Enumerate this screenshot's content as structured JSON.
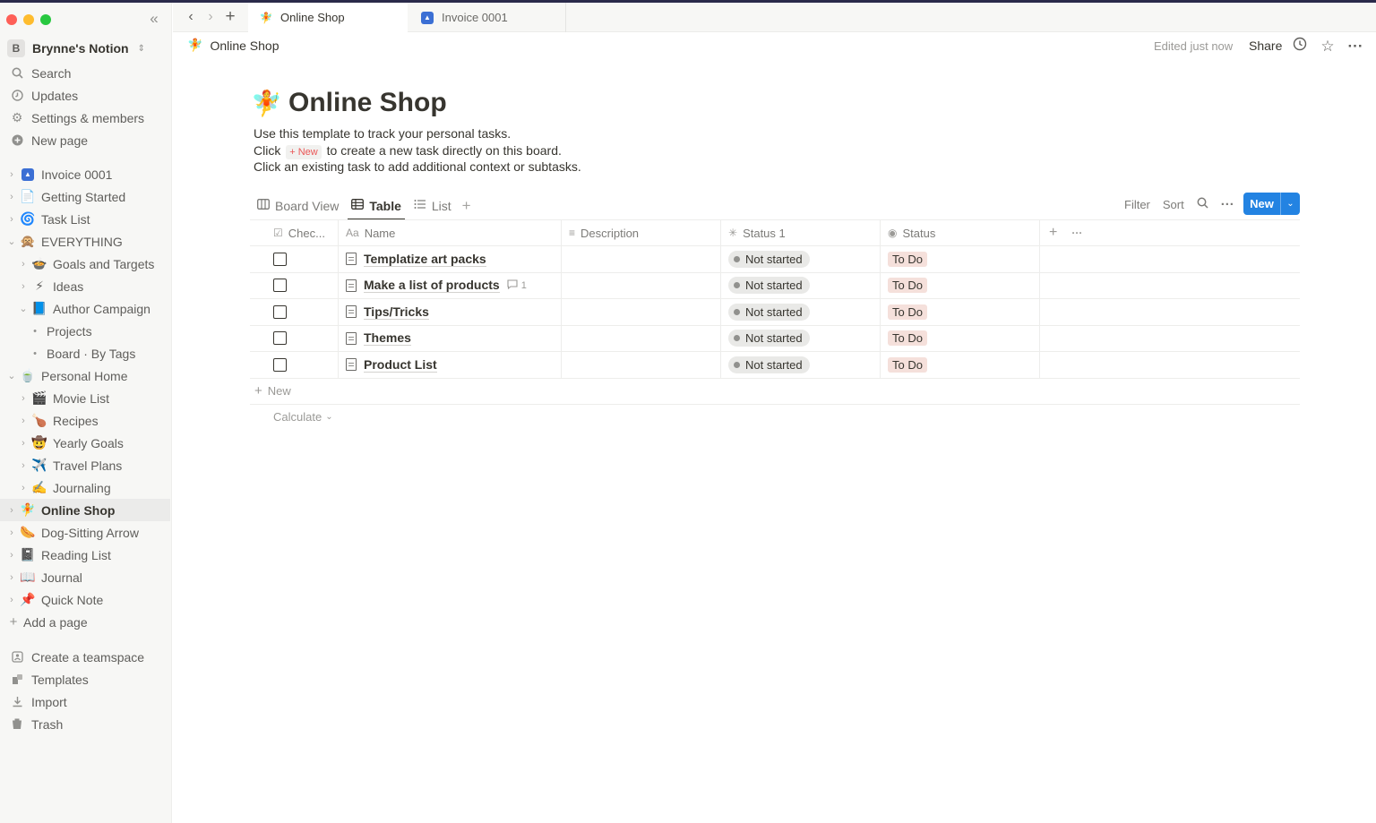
{
  "window": {
    "title": "Online Shop"
  },
  "tabs": [
    {
      "label": "Online Shop",
      "icon": "fairy-emoji",
      "active": true
    },
    {
      "label": "Invoice 0001",
      "icon": "invoice-icon",
      "active": false
    }
  ],
  "sidebar": {
    "workspace_badge": "B",
    "workspace_name": "Brynne's Notion",
    "top_items": [
      {
        "label": "Search",
        "icon": "search-icon"
      },
      {
        "label": "Updates",
        "icon": "clock-icon"
      },
      {
        "label": "Settings & members",
        "icon": "gear-icon"
      },
      {
        "label": "New page",
        "icon": "plus-circle-icon"
      }
    ],
    "tree": [
      {
        "label": "Invoice 0001",
        "emoji": "🔷"
      },
      {
        "label": "Getting Started",
        "emoji": "📄"
      },
      {
        "label": "Task List",
        "emoji": "🌀"
      },
      {
        "label": "EVERYTHING",
        "emoji": "🙊"
      },
      {
        "label": "Goals and Targets",
        "emoji": "🍲"
      },
      {
        "label": "Ideas",
        "emoji": "⚡"
      },
      {
        "label": "Author Campaign",
        "emoji": "📘"
      },
      {
        "label": "Projects",
        "emoji": ""
      },
      {
        "label": "Board · By Tags",
        "emoji": ""
      },
      {
        "label": "Personal Home",
        "emoji": "🍵"
      },
      {
        "label": "Movie List",
        "emoji": "🎬"
      },
      {
        "label": "Recipes",
        "emoji": "🍗"
      },
      {
        "label": "Yearly Goals",
        "emoji": "🤠"
      },
      {
        "label": "Travel Plans",
        "emoji": "✈️"
      },
      {
        "label": "Journaling",
        "emoji": "✍️"
      },
      {
        "label": "Online Shop",
        "emoji": "🧚"
      },
      {
        "label": "Dog-Sitting Arrow",
        "emoji": "🌭"
      },
      {
        "label": "Reading List",
        "emoji": "📓"
      },
      {
        "label": "Journal",
        "emoji": "📖"
      },
      {
        "label": "Quick Note",
        "emoji": "📌"
      }
    ],
    "add_page": "Add a page",
    "bottom_items": [
      {
        "label": "Create a teamspace",
        "icon": "teamspace-icon"
      },
      {
        "label": "Templates",
        "icon": "templates-icon"
      },
      {
        "label": "Import",
        "icon": "import-icon"
      },
      {
        "label": "Trash",
        "icon": "trash-icon"
      }
    ]
  },
  "header": {
    "breadcrumb": "Online Shop",
    "edited": "Edited just now",
    "share": "Share"
  },
  "page": {
    "emoji": "🧚",
    "title": "Online Shop",
    "desc_line1": "Use this template to track your personal tasks.",
    "desc_line2_pre": "Click",
    "desc_line2_chip": "+ New",
    "desc_line2_post": "to create a new task directly on this board.",
    "desc_line3": "Click an existing task to add additional context or subtasks."
  },
  "views": {
    "items": [
      {
        "label": "Board View",
        "icon": "board-icon"
      },
      {
        "label": "Table",
        "icon": "table-icon"
      },
      {
        "label": "List",
        "icon": "list-icon"
      }
    ],
    "filter": "Filter",
    "sort": "Sort",
    "new": "New"
  },
  "table": {
    "columns": [
      "Chec...",
      "Name",
      "Description",
      "Status 1",
      "Status"
    ],
    "rows": [
      {
        "name": "Templatize art packs",
        "comments": "",
        "status1": "Not started",
        "status": "To Do"
      },
      {
        "name": "Make a list of products",
        "comments": "1",
        "status1": "Not started",
        "status": "To Do"
      },
      {
        "name": "Tips/Tricks",
        "comments": "",
        "status1": "Not started",
        "status": "To Do"
      },
      {
        "name": "Themes",
        "comments": "",
        "status1": "Not started",
        "status": "To Do"
      },
      {
        "name": "Product List",
        "comments": "",
        "status1": "Not started",
        "status": "To Do"
      }
    ],
    "add_row": "New",
    "calculate": "Calculate"
  },
  "colors": {
    "accent": "#2383e2",
    "todo_bg": "#f5e0db",
    "sidebar_bg": "#f7f7f5"
  }
}
